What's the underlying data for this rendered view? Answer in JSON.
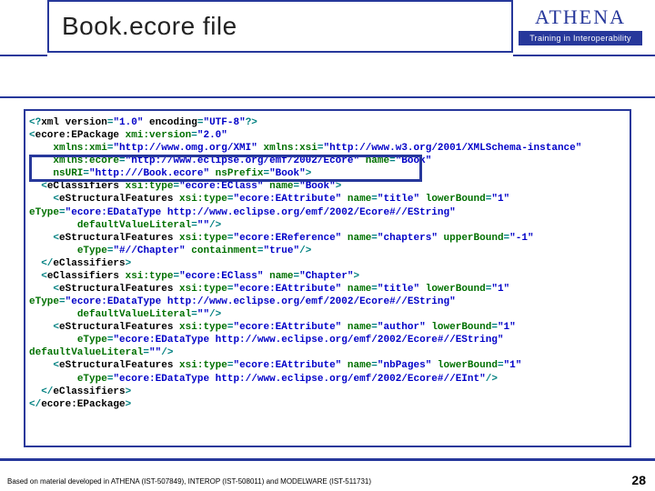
{
  "header": {
    "title": "Book.ecore file",
    "logo_text": "ATHENA",
    "logo_sub": "Training in Interoperability"
  },
  "code": {
    "lines": [
      [
        [
          "<?",
          "s-teal"
        ],
        [
          "xml version",
          "s-dark"
        ],
        [
          "=",
          "s-teal"
        ],
        [
          "\"1.0\" ",
          "s-blue"
        ],
        [
          "encoding",
          "s-dark"
        ],
        [
          "=",
          "s-teal"
        ],
        [
          "\"UTF-8\"",
          "s-blue"
        ],
        [
          "?>",
          "s-teal"
        ]
      ],
      [
        [
          "<",
          "s-teal"
        ],
        [
          "ecore:EPackage ",
          "s-dark"
        ],
        [
          "xmi:version",
          "s-green"
        ],
        [
          "=",
          "s-teal"
        ],
        [
          "\"2.0\"",
          "s-blue"
        ]
      ],
      [
        [
          "    ",
          "s-dark"
        ],
        [
          "xmlns:xmi",
          "s-green"
        ],
        [
          "=",
          "s-teal"
        ],
        [
          "\"http://www.omg.org/XMI\" ",
          "s-blue"
        ],
        [
          "xmlns:xsi",
          "s-green"
        ],
        [
          "=",
          "s-teal"
        ],
        [
          "\"http://www.w3.org/2001/XMLSchema-instance\"",
          "s-blue"
        ]
      ],
      [
        [
          "    ",
          "s-dark"
        ],
        [
          "xmlns:ecore",
          "s-green"
        ],
        [
          "=",
          "s-teal"
        ],
        [
          "\"http://www.eclipse.org/emf/2002/Ecore\" ",
          "s-blue"
        ],
        [
          "name",
          "s-green"
        ],
        [
          "=",
          "s-teal"
        ],
        [
          "\"Book\"",
          "s-blue"
        ]
      ],
      [
        [
          "    ",
          "s-dark"
        ],
        [
          "nsURI",
          "s-green"
        ],
        [
          "=",
          "s-teal"
        ],
        [
          "\"http:///Book.ecore\" ",
          "s-blue"
        ],
        [
          "nsPrefix",
          "s-green"
        ],
        [
          "=",
          "s-teal"
        ],
        [
          "\"Book\"",
          "s-blue"
        ],
        [
          ">",
          "s-teal"
        ]
      ],
      [
        [
          "  <",
          "s-teal"
        ],
        [
          "eClassifiers ",
          "s-dark"
        ],
        [
          "xsi:type",
          "s-green"
        ],
        [
          "=",
          "s-teal"
        ],
        [
          "\"ecore:EClass\" ",
          "s-blue"
        ],
        [
          "name",
          "s-green"
        ],
        [
          "=",
          "s-teal"
        ],
        [
          "\"Book\"",
          "s-blue"
        ],
        [
          ">",
          "s-teal"
        ]
      ],
      [
        [
          "    <",
          "s-teal"
        ],
        [
          "eStructuralFeatures ",
          "s-dark"
        ],
        [
          "xsi:type",
          "s-green"
        ],
        [
          "=",
          "s-teal"
        ],
        [
          "\"ecore:EAttribute\" ",
          "s-blue"
        ],
        [
          "name",
          "s-green"
        ],
        [
          "=",
          "s-teal"
        ],
        [
          "\"title\" ",
          "s-blue"
        ],
        [
          "lowerBound",
          "s-green"
        ],
        [
          "=",
          "s-teal"
        ],
        [
          "\"1\"",
          "s-blue"
        ]
      ],
      [
        [
          "eType",
          "s-green"
        ],
        [
          "=",
          "s-teal"
        ],
        [
          "\"ecore:EDataType http://www.eclipse.org/emf/2002/Ecore#//EString\"",
          "s-blue"
        ]
      ],
      [
        [
          "        ",
          "s-dark"
        ],
        [
          "defaultValueLiteral",
          "s-green"
        ],
        [
          "=",
          "s-teal"
        ],
        [
          "\"\"",
          "s-blue"
        ],
        [
          "/>",
          "s-teal"
        ]
      ],
      [
        [
          "    <",
          "s-teal"
        ],
        [
          "eStructuralFeatures ",
          "s-dark"
        ],
        [
          "xsi:type",
          "s-green"
        ],
        [
          "=",
          "s-teal"
        ],
        [
          "\"ecore:EReference\" ",
          "s-blue"
        ],
        [
          "name",
          "s-green"
        ],
        [
          "=",
          "s-teal"
        ],
        [
          "\"chapters\" ",
          "s-blue"
        ],
        [
          "upperBound",
          "s-green"
        ],
        [
          "=",
          "s-teal"
        ],
        [
          "\"-1\"",
          "s-blue"
        ]
      ],
      [
        [
          "        ",
          "s-dark"
        ],
        [
          "eType",
          "s-green"
        ],
        [
          "=",
          "s-teal"
        ],
        [
          "\"#//Chapter\" ",
          "s-blue"
        ],
        [
          "containment",
          "s-green"
        ],
        [
          "=",
          "s-teal"
        ],
        [
          "\"true\"",
          "s-blue"
        ],
        [
          "/>",
          "s-teal"
        ]
      ],
      [
        [
          "  </",
          "s-teal"
        ],
        [
          "eClassifiers",
          "s-dark"
        ],
        [
          ">",
          "s-teal"
        ]
      ],
      [
        [
          "  <",
          "s-teal"
        ],
        [
          "eClassifiers ",
          "s-dark"
        ],
        [
          "xsi:type",
          "s-green"
        ],
        [
          "=",
          "s-teal"
        ],
        [
          "\"ecore:EClass\" ",
          "s-blue"
        ],
        [
          "name",
          "s-green"
        ],
        [
          "=",
          "s-teal"
        ],
        [
          "\"Chapter\"",
          "s-blue"
        ],
        [
          ">",
          "s-teal"
        ]
      ],
      [
        [
          "    <",
          "s-teal"
        ],
        [
          "eStructuralFeatures ",
          "s-dark"
        ],
        [
          "xsi:type",
          "s-green"
        ],
        [
          "=",
          "s-teal"
        ],
        [
          "\"ecore:EAttribute\" ",
          "s-blue"
        ],
        [
          "name",
          "s-green"
        ],
        [
          "=",
          "s-teal"
        ],
        [
          "\"title\" ",
          "s-blue"
        ],
        [
          "lowerBound",
          "s-green"
        ],
        [
          "=",
          "s-teal"
        ],
        [
          "\"1\"",
          "s-blue"
        ]
      ],
      [
        [
          "eType",
          "s-green"
        ],
        [
          "=",
          "s-teal"
        ],
        [
          "\"ecore:EDataType http://www.eclipse.org/emf/2002/Ecore#//EString\"",
          "s-blue"
        ]
      ],
      [
        [
          "        ",
          "s-dark"
        ],
        [
          "defaultValueLiteral",
          "s-green"
        ],
        [
          "=",
          "s-teal"
        ],
        [
          "\"\"",
          "s-blue"
        ],
        [
          "/>",
          "s-teal"
        ]
      ],
      [
        [
          "    <",
          "s-teal"
        ],
        [
          "eStructuralFeatures ",
          "s-dark"
        ],
        [
          "xsi:type",
          "s-green"
        ],
        [
          "=",
          "s-teal"
        ],
        [
          "\"ecore:EAttribute\" ",
          "s-blue"
        ],
        [
          "name",
          "s-green"
        ],
        [
          "=",
          "s-teal"
        ],
        [
          "\"author\" ",
          "s-blue"
        ],
        [
          "lowerBound",
          "s-green"
        ],
        [
          "=",
          "s-teal"
        ],
        [
          "\"1\"",
          "s-blue"
        ]
      ],
      [
        [
          "        ",
          "s-dark"
        ],
        [
          "eType",
          "s-green"
        ],
        [
          "=",
          "s-teal"
        ],
        [
          "\"ecore:EDataType http://www.eclipse.org/emf/2002/Ecore#//EString\"",
          "s-blue"
        ]
      ],
      [
        [
          "defaultValueLiteral",
          "s-green"
        ],
        [
          "=",
          "s-teal"
        ],
        [
          "\"\"",
          "s-blue"
        ],
        [
          "/>",
          "s-teal"
        ]
      ],
      [
        [
          "    <",
          "s-teal"
        ],
        [
          "eStructuralFeatures ",
          "s-dark"
        ],
        [
          "xsi:type",
          "s-green"
        ],
        [
          "=",
          "s-teal"
        ],
        [
          "\"ecore:EAttribute\" ",
          "s-blue"
        ],
        [
          "name",
          "s-green"
        ],
        [
          "=",
          "s-teal"
        ],
        [
          "\"nbPages\" ",
          "s-blue"
        ],
        [
          "lowerBound",
          "s-green"
        ],
        [
          "=",
          "s-teal"
        ],
        [
          "\"1\"",
          "s-blue"
        ]
      ],
      [
        [
          "        ",
          "s-dark"
        ],
        [
          "eType",
          "s-green"
        ],
        [
          "=",
          "s-teal"
        ],
        [
          "\"ecore:EDataType http://www.eclipse.org/emf/2002/Ecore#//EInt\"",
          "s-blue"
        ],
        [
          "/>",
          "s-teal"
        ]
      ],
      [
        [
          "  </",
          "s-teal"
        ],
        [
          "eClassifiers",
          "s-dark"
        ],
        [
          ">",
          "s-teal"
        ]
      ],
      [
        [
          "</",
          "s-teal"
        ],
        [
          "ecore:EPackage",
          "s-dark"
        ],
        [
          ">",
          "s-teal"
        ]
      ]
    ]
  },
  "footer": {
    "credit": "Based on material developed in ATHENA (IST-507849), INTEROP (IST-508011) and MODELWARE (IST-511731)",
    "page": "28"
  }
}
